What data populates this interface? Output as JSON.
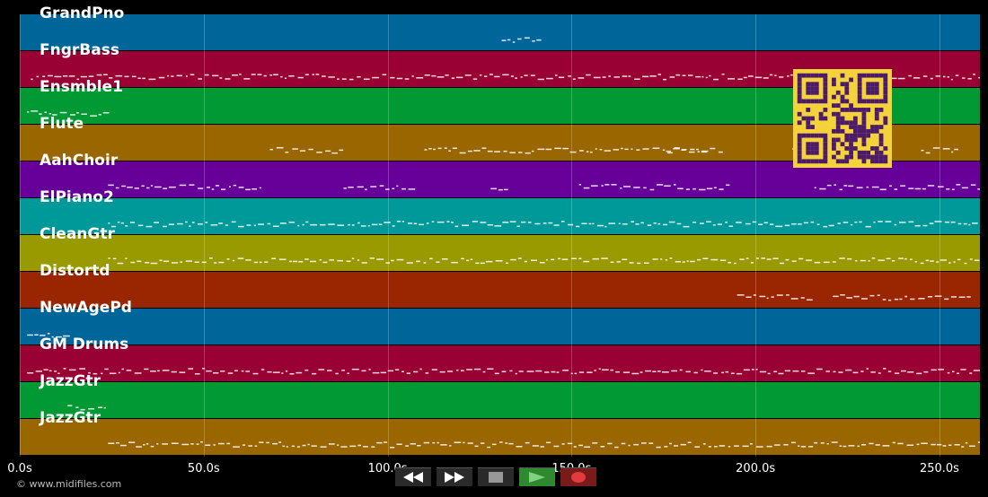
{
  "tracks": [
    {
      "name": "GrandPno",
      "color": "#006699"
    },
    {
      "name": "FngrBass",
      "color": "#990033"
    },
    {
      "name": "Ensmble1",
      "color": "#009933"
    },
    {
      "name": "Flute",
      "color": "#996600"
    },
    {
      "name": "AahChoir",
      "color": "#660099"
    },
    {
      "name": "ElPiano2",
      "color": "#009999"
    },
    {
      "name": "CleanGtr",
      "color": "#999900"
    },
    {
      "name": "Distortd",
      "color": "#992600"
    },
    {
      "name": "NewAgePd",
      "color": "#006699"
    },
    {
      "name": "GM Drums",
      "color": "#990033"
    },
    {
      "name": "JazzGtr",
      "color": "#009933"
    },
    {
      "name": "JazzGtr",
      "color": "#996600"
    }
  ],
  "axis": {
    "tick_labels": [
      "0.0s",
      "50.0s",
      "100.0s",
      "150.0s",
      "200.0s",
      "250.0s"
    ],
    "tick_seconds": [
      0,
      50,
      100,
      150,
      200,
      250
    ],
    "max_seconds": 261
  },
  "copyright": "© www.midifiles.com",
  "transport": [
    {
      "name": "rewind",
      "icon": "rewind-icon"
    },
    {
      "name": "fast-forward",
      "icon": "fast-forward-icon"
    },
    {
      "name": "stop",
      "icon": "stop-icon"
    },
    {
      "name": "play",
      "icon": "play-icon"
    },
    {
      "name": "record",
      "icon": "record-icon"
    }
  ],
  "note_spans": [
    {
      "track": 0,
      "segments": [
        [
          131,
          142
        ]
      ]
    },
    {
      "track": 1,
      "segments": [
        [
          3,
          261
        ]
      ]
    },
    {
      "track": 2,
      "segments": [
        [
          2,
          23
        ]
      ]
    },
    {
      "track": 3,
      "segments": [
        [
          68,
          88
        ],
        [
          110,
          170
        ],
        [
          172,
          188
        ],
        [
          176,
          190
        ],
        [
          210,
          217
        ],
        [
          245,
          255
        ]
      ]
    },
    {
      "track": 4,
      "segments": [
        [
          24,
          66
        ],
        [
          88,
          108
        ],
        [
          128,
          132
        ],
        [
          152,
          193
        ],
        [
          216,
          261
        ]
      ]
    },
    {
      "track": 5,
      "segments": [
        [
          24,
          261
        ]
      ]
    },
    {
      "track": 6,
      "segments": [
        [
          24,
          261
        ]
      ]
    },
    {
      "track": 7,
      "segments": [
        [
          195,
          216
        ],
        [
          221,
          258
        ]
      ]
    },
    {
      "track": 8,
      "segments": [
        [
          2,
          13
        ]
      ]
    },
    {
      "track": 9,
      "segments": [
        [
          2,
          261
        ]
      ]
    },
    {
      "track": 10,
      "segments": [
        [
          13,
          23
        ]
      ]
    },
    {
      "track": 11,
      "segments": [
        [
          24,
          261
        ]
      ]
    }
  ]
}
